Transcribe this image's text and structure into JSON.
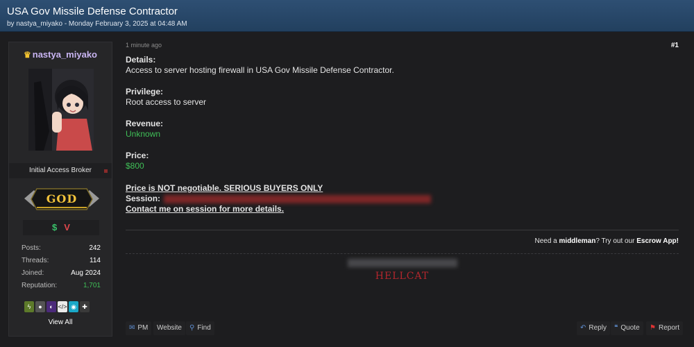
{
  "thread": {
    "title": "USA Gov Missile Defense Contractor",
    "meta": "by nastya_miyako - Monday February 3, 2025 at 04:48 AM"
  },
  "author": {
    "username": "nastya_miyako",
    "user_title": "Initial Access Broker",
    "rank": "GOD",
    "badge_1": "$",
    "badge_2": "V",
    "stats": [
      {
        "label": "Posts:",
        "value": "242"
      },
      {
        "label": "Threads:",
        "value": "114"
      },
      {
        "label": "Joined:",
        "value": "Aug 2024"
      },
      {
        "label": "Reputation:",
        "value": "1,701"
      }
    ],
    "view_all": "View All"
  },
  "post": {
    "time": "1 minute ago",
    "number": "#1",
    "details_label": "Details:",
    "details_value": "Access to server hosting firewall in USA Gov Missile Defense Contractor.",
    "privilege_label": "Privilege:",
    "privilege_value": "Root access to server",
    "revenue_label": "Revenue:",
    "revenue_value": "Unknown",
    "price_label": "Price:",
    "price_value": "$800",
    "notice": "Price is NOT negotiable. SERIOUS BUYERS ONLY",
    "session_label": "Session:",
    "contact": "Contact me on session for more details.",
    "escrow_prefix": "Need a ",
    "escrow_middle": "middleman",
    "escrow_mid2": "? Try out our ",
    "escrow_app": "Escrow App!",
    "signature": "HELLCAT"
  },
  "actions": {
    "pm": "PM",
    "website": "Website",
    "find": "Find",
    "reply": "Reply",
    "quote": "Quote",
    "report": "Report"
  },
  "colors": {
    "header": "#2a4a6e",
    "green": "#3fbf57",
    "username": "#c9b5f2",
    "rank_gold": "#f1c23b",
    "signature_red": "#b3262d"
  },
  "icons": [
    "crown-icon",
    "mail-icon",
    "search-icon",
    "reply-icon",
    "quote-icon",
    "flag-icon"
  ]
}
